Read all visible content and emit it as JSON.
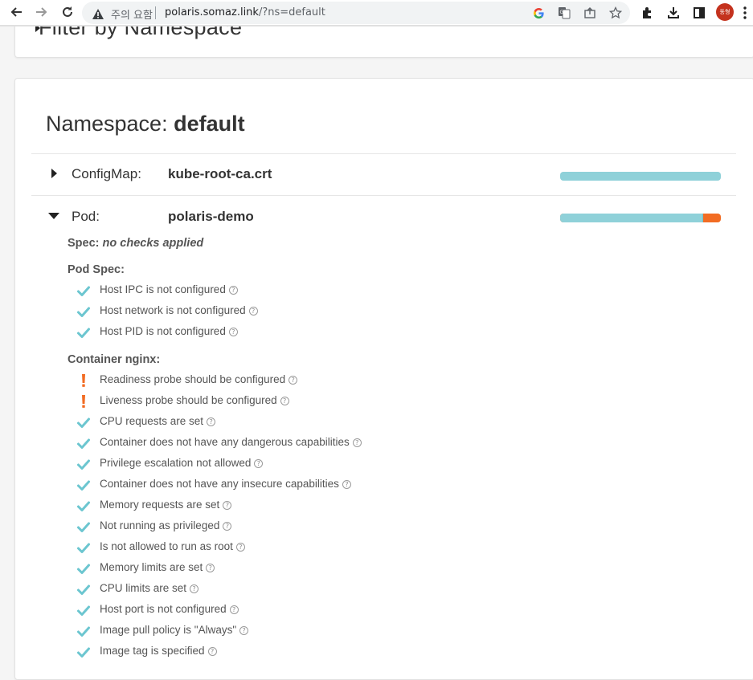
{
  "browser": {
    "security_label": "주의 요함",
    "url_host": "polaris.somaz.link",
    "url_path": "/?ns=default",
    "avatar_text": "동형",
    "icons": [
      "back-icon",
      "forward-icon",
      "reload-icon",
      "warning-icon",
      "google-icon",
      "translate-icon",
      "share-icon",
      "bookmark-star-icon",
      "extensions-icon",
      "download-icon",
      "sidepanel-icon",
      "menu-icon"
    ]
  },
  "filter": {
    "title": "Filter by Namespace"
  },
  "namespace": {
    "label": "Namespace:",
    "name": "default"
  },
  "colors": {
    "passing": "#8fd1d9",
    "warning": "#f26c23",
    "check_icon": "#6cc6d0"
  },
  "resources": [
    {
      "kind": "ConfigMap:",
      "name": "kube-root-ca.crt",
      "expanded": false,
      "score_fraction": 1.0
    },
    {
      "kind": "Pod:",
      "name": "polaris-demo",
      "expanded": true,
      "score_fraction": 0.89,
      "spec": {
        "label": "Spec:",
        "value": "no checks applied"
      },
      "pod_spec": {
        "label": "Pod Spec:",
        "checks": [
          {
            "status": "pass",
            "text": "Host IPC is not configured"
          },
          {
            "status": "pass",
            "text": "Host network is not configured"
          },
          {
            "status": "pass",
            "text": "Host PID is not configured"
          }
        ]
      },
      "container": {
        "label": "Container nginx:",
        "checks": [
          {
            "status": "warning",
            "text": "Readiness probe should be configured"
          },
          {
            "status": "warning",
            "text": "Liveness probe should be configured"
          },
          {
            "status": "pass",
            "text": "CPU requests are set"
          },
          {
            "status": "pass",
            "text": "Container does not have any dangerous capabilities"
          },
          {
            "status": "pass",
            "text": "Privilege escalation not allowed"
          },
          {
            "status": "pass",
            "text": "Container does not have any insecure capabilities"
          },
          {
            "status": "pass",
            "text": "Memory requests are set"
          },
          {
            "status": "pass",
            "text": "Not running as privileged"
          },
          {
            "status": "pass",
            "text": "Is not allowed to run as root"
          },
          {
            "status": "pass",
            "text": "Memory limits are set"
          },
          {
            "status": "pass",
            "text": "CPU limits are set"
          },
          {
            "status": "pass",
            "text": "Host port is not configured"
          },
          {
            "status": "pass",
            "text": "Image pull policy is \"Always\""
          },
          {
            "status": "pass",
            "text": "Image tag is specified"
          }
        ]
      }
    }
  ]
}
